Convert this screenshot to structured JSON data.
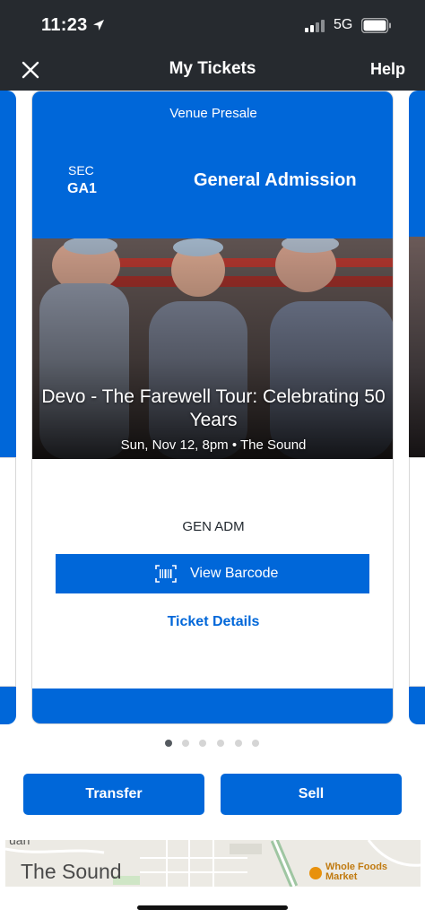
{
  "status_bar": {
    "time": "11:23",
    "network": "5G"
  },
  "header": {
    "title": "My Tickets",
    "help_label": "Help"
  },
  "ticket": {
    "presale_label": "Venue Presale",
    "section_label": "SEC",
    "section_value": "GA1",
    "admission_type": "General Admission",
    "event_title": "Devo - The Farewell Tour: Celebrating 50 Years",
    "event_subtitle": "Sun, Nov 12, 8pm • The Sound",
    "seat_label": "GEN ADM",
    "barcode_button_label": "View Barcode",
    "details_link_label": "Ticket Details"
  },
  "carousel": {
    "total": 6,
    "active_index": 0
  },
  "actions": {
    "transfer_label": "Transfer",
    "sell_label": "Sell"
  },
  "map": {
    "venue_label": "The Sound",
    "partial_label": "uan",
    "store_label_line1": "Whole Foods",
    "store_label_line2": "Market"
  },
  "colors": {
    "brand_blue": "#0067d9",
    "topbar": "#262a2f"
  }
}
